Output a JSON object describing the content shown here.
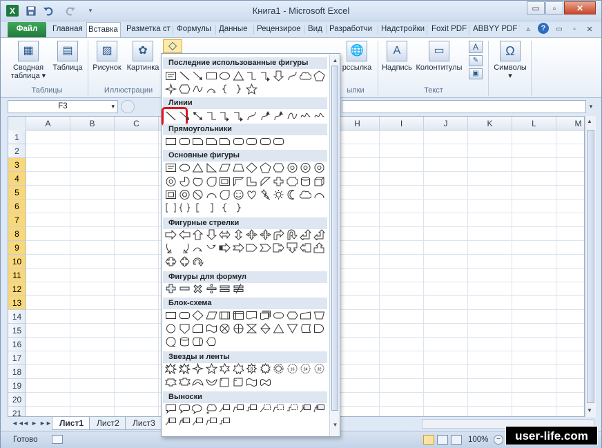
{
  "window": {
    "title": "Книга1  -  Microsoft Excel",
    "app_icon": "X"
  },
  "window_controls": {
    "minimize": "▭",
    "maximize": "▫",
    "close": "✕"
  },
  "tabs": [
    {
      "label": "Файл"
    },
    {
      "label": "Главная"
    },
    {
      "label": "Вставка"
    },
    {
      "label": "Разметка ст"
    },
    {
      "label": "Формулы"
    },
    {
      "label": "Данные"
    },
    {
      "label": "Рецензирое"
    },
    {
      "label": "Вид"
    },
    {
      "label": "Разработчи"
    },
    {
      "label": "Надстройки"
    },
    {
      "label": "Foxit PDF"
    },
    {
      "label": "ABBYY PDF T"
    }
  ],
  "ribbon": {
    "pivot_label": "Сводная таблица ▾",
    "table_label": "Таблица",
    "picture_label": "Рисунок",
    "clipart_label": "Картинка",
    "hyperlink_label": "рссылка",
    "textbox_label": "Надпись",
    "header_label": "Колонтитулы",
    "symbols_label": "Символы",
    "symbols_arrow": "▾",
    "group_tables": "Таблицы",
    "group_illustrations": "Иллюстрации",
    "group_links": "ылки",
    "group_text": "Текст"
  },
  "formula_bar": {
    "name_box": "F3",
    "name_arrow": "▾",
    "expand": "▾"
  },
  "columns": [
    "A",
    "B",
    "C",
    "",
    "",
    "",
    "",
    "H",
    "I",
    "J",
    "K",
    "L",
    "M"
  ],
  "rows": [
    "1",
    "2",
    "3",
    "4",
    "5",
    "6",
    "7",
    "8",
    "9",
    "10",
    "11",
    "12",
    "13",
    "14",
    "15",
    "16",
    "17",
    "18",
    "19",
    "20",
    "21",
    "22"
  ],
  "selected_rows": [
    "3",
    "4",
    "5",
    "6",
    "7",
    "8",
    "9",
    "10",
    "11",
    "12",
    "13"
  ],
  "sheet_tabs": [
    "Лист1",
    "Лист2",
    "Лист3"
  ],
  "sheet_nav": {
    "first": "◄◄",
    "prev": "◄",
    "next": "►",
    "last": "►►"
  },
  "status": {
    "ready": "Готово",
    "zoom": "100%"
  },
  "watermark": "user-life.com",
  "shapes_gallery": {
    "categories": [
      {
        "label": "Последние использованные фигуры"
      },
      {
        "label": "Линии"
      },
      {
        "label": "Прямоугольники"
      },
      {
        "label": "Основные фигуры"
      },
      {
        "label": "Фигурные стрелки"
      },
      {
        "label": "Фигуры для формул"
      },
      {
        "label": "Блок-схема"
      },
      {
        "label": "Звезды и ленты"
      },
      {
        "label": "Выноски"
      }
    ],
    "selected_shape": "line",
    "scroll_up": "▲",
    "scroll_down": "▼"
  },
  "colors": {
    "selection_red": "#e0161f",
    "row_highlight": "#f8d87b",
    "file_tab": "#217a3a"
  }
}
